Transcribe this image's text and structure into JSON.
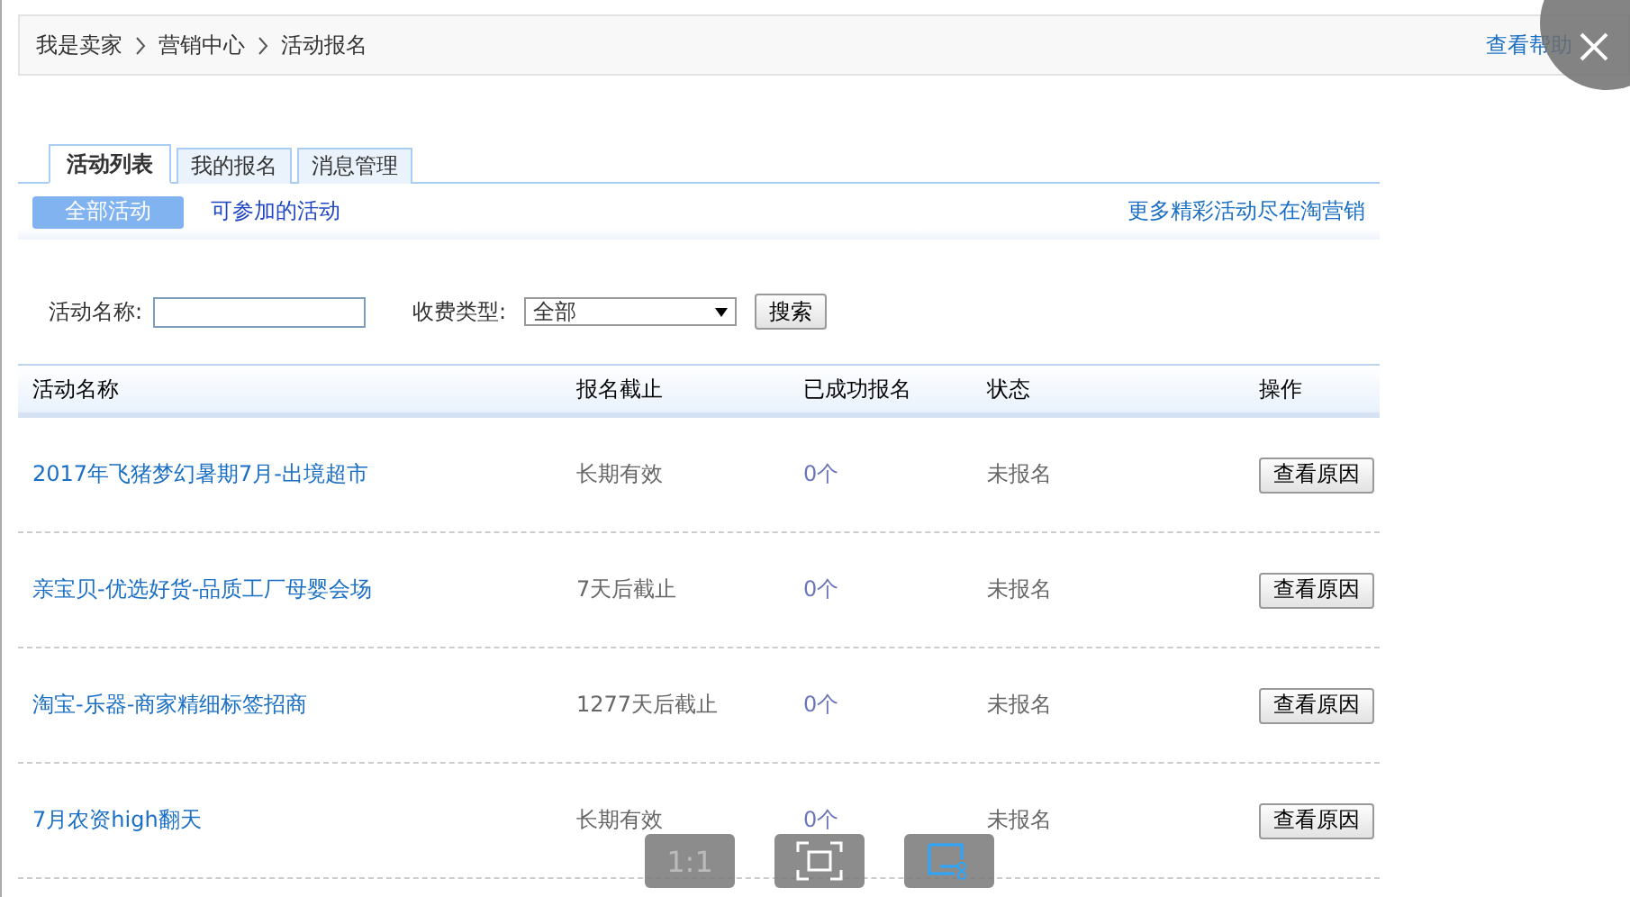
{
  "breadcrumb": [
    "我是卖家",
    "营销中心",
    "活动报名"
  ],
  "help_link": "查看帮助",
  "tabs": [
    {
      "label": "活动列表",
      "selected": true
    },
    {
      "label": "我的报名",
      "selected": false
    },
    {
      "label": "消息管理",
      "selected": false
    }
  ],
  "filters": [
    {
      "label": "全部活动",
      "selected": true
    },
    {
      "label": "可参加的活动",
      "selected": false
    }
  ],
  "more_link": "更多精彩活动尽在淘营销",
  "search": {
    "name_label": "活动名称:",
    "fee_label": "收费类型:",
    "fee_value": "全部",
    "button": "搜索"
  },
  "table": {
    "columns": [
      "活动名称",
      "报名截止",
      "已成功报名",
      "状态",
      "操作"
    ],
    "rows": [
      {
        "name": "2017年飞猪梦幻暑期7月-出境超市",
        "deadline": "长期有效",
        "count": "0个",
        "status": "未报名",
        "action": "查看原因"
      },
      {
        "name": "亲宝贝-优选好货-品质工厂母婴会场",
        "deadline": "7天后截止",
        "count": "0个",
        "status": "未报名",
        "action": "查看原因"
      },
      {
        "name": "淘宝-乐器-商家精细标签招商",
        "deadline": "1277天后截止",
        "count": "0个",
        "status": "未报名",
        "action": "查看原因"
      },
      {
        "name": "7月农资high翻天",
        "deadline": "长期有效",
        "count": "0个",
        "status": "未报名",
        "action": "查看原因"
      }
    ]
  },
  "viewer_toolbar": {
    "actual_size": "1:1"
  }
}
